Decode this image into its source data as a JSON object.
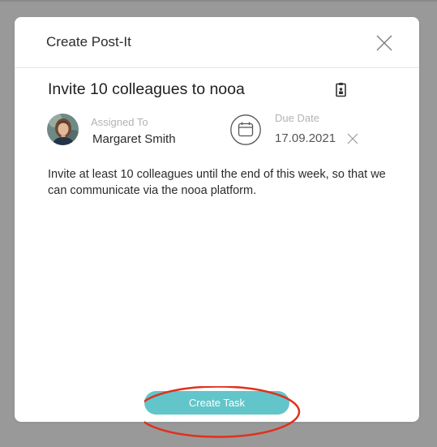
{
  "modal": {
    "title": "Create Post-It",
    "close_icon": "close-icon"
  },
  "task": {
    "title": "Invite 10 colleagues to nooa",
    "clipboard_icon": "clipboard-icon",
    "assigned_label": "Assigned To",
    "assigned_name": "Margaret Smith",
    "due_label": "Due Date",
    "due_value": "17.09.2021",
    "calendar_icon": "calendar-icon",
    "clear_icon": "close-icon",
    "description": "Invite at least 10 colleagues until the end of this week, so that we can communicate via the nooa platform."
  },
  "footer": {
    "create_label": "Create Task"
  },
  "colors": {
    "backdrop": "#999999",
    "modal_bg": "#ffffff",
    "accent": "#62c5c9",
    "highlight": "#e0301e",
    "muted_text": "#b3b3b3"
  }
}
